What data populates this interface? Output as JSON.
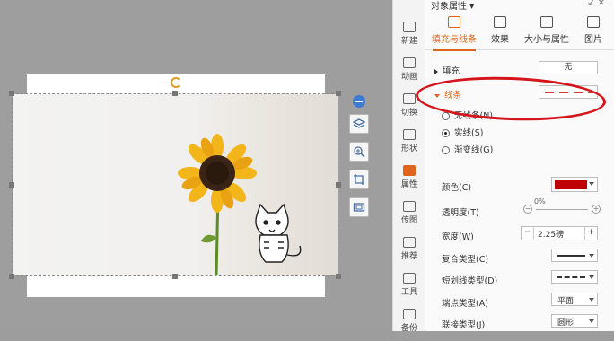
{
  "panel": {
    "title": "对象属性",
    "top_icons": "↙ ✕",
    "tabs": [
      {
        "label": "填充与线条",
        "icon": "fill-bucket-icon"
      },
      {
        "label": "效果",
        "icon": "cube-icon"
      },
      {
        "label": "大小与属性",
        "icon": "size-grid-icon"
      },
      {
        "label": "图片",
        "icon": "image-icon"
      }
    ],
    "fill": {
      "label": "填充",
      "value": "无"
    },
    "line": {
      "label": "线条"
    },
    "line_options": [
      "无线条(N)",
      "实线(S)",
      "渐变线(G)"
    ],
    "color": {
      "label": "颜色(C)",
      "value": "#c00000"
    },
    "transparency": {
      "label": "透明度(T)",
      "value": "0%"
    },
    "width": {
      "label": "宽度(W)",
      "value": "2.25磅",
      "minus": "−",
      "plus": "+"
    },
    "compound": {
      "label": "复合类型(C)"
    },
    "dash": {
      "label": "短划线类型(D)"
    },
    "cap": {
      "label": "端点类型(A)",
      "value": "平面"
    },
    "join": {
      "label": "联接类型(J)",
      "value": "圆形"
    }
  },
  "strip": [
    {
      "label": "新建",
      "icon": "new-icon"
    },
    {
      "label": "动画",
      "icon": "animation-icon"
    },
    {
      "label": "切换",
      "icon": "transition-icon"
    },
    {
      "label": "形状",
      "icon": "shape-icon"
    },
    {
      "label": "属性",
      "icon": "property-icon"
    },
    {
      "label": "传图",
      "icon": "upload-image-icon"
    },
    {
      "label": "推荐",
      "icon": "recommend-icon"
    },
    {
      "label": "工具",
      "icon": "toolbox-icon"
    },
    {
      "label": "备份",
      "icon": "backup-icon"
    }
  ],
  "colors": {
    "accent": "#e0641c",
    "annotation": "#d4151c",
    "line_color": "#c00000"
  }
}
